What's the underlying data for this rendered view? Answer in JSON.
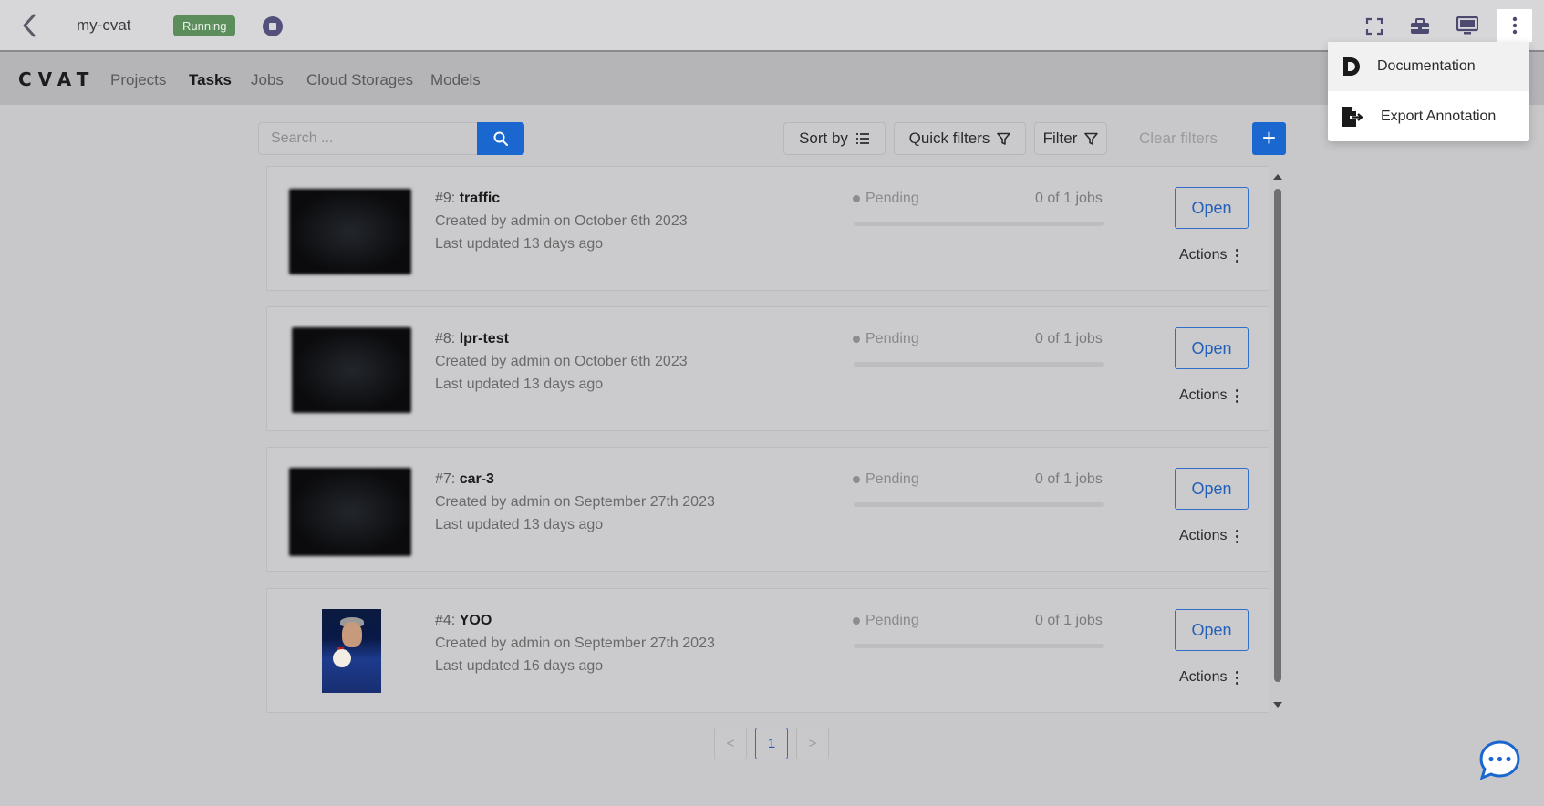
{
  "workspace": {
    "name": "my-cvat",
    "status": "Running"
  },
  "nav": {
    "logo": "CVAT",
    "items": [
      {
        "label": "Projects",
        "active": false
      },
      {
        "label": "Tasks",
        "active": true
      },
      {
        "label": "Jobs",
        "active": false
      },
      {
        "label": "Cloud Storages",
        "active": false
      },
      {
        "label": "Models",
        "active": false
      }
    ]
  },
  "toolbar": {
    "search_placeholder": "Search ...",
    "sort_by": "Sort by",
    "quick_filters": "Quick filters",
    "filter": "Filter",
    "clear_filters": "Clear filters",
    "add": "+"
  },
  "tasks": [
    {
      "id": "#9:",
      "name": "traffic",
      "created": "Created by admin on October 6th 2023",
      "updated": "Last updated 13 days ago",
      "status": "Pending",
      "jobs": "0 of 1 jobs",
      "open": "Open",
      "actions": "Actions",
      "progress": 0
    },
    {
      "id": "#8:",
      "name": "lpr-test",
      "created": "Created by admin on October 6th 2023",
      "updated": "Last updated 13 days ago",
      "status": "Pending",
      "jobs": "0 of 1 jobs",
      "open": "Open",
      "actions": "Actions",
      "progress": 0
    },
    {
      "id": "#7:",
      "name": "car-3",
      "created": "Created by admin on September 27th 2023",
      "updated": "Last updated 13 days ago",
      "status": "Pending",
      "jobs": "0 of 1 jobs",
      "open": "Open",
      "actions": "Actions",
      "progress": 0
    },
    {
      "id": "#4:",
      "name": "YOO",
      "created": "Created by admin on September 27th 2023",
      "updated": "Last updated 16 days ago",
      "status": "Pending",
      "jobs": "0 of 1 jobs",
      "open": "Open",
      "actions": "Actions",
      "progress": 0
    }
  ],
  "pagination": {
    "prev": "<",
    "current": "1",
    "next": ">"
  },
  "menu": {
    "items": [
      {
        "label": "Documentation",
        "icon": "documentation-icon"
      },
      {
        "label": "Export Annotation",
        "icon": "export-icon"
      }
    ]
  },
  "colors": {
    "accent": "#1a67d0",
    "running_badge": "#5c8e5c"
  }
}
